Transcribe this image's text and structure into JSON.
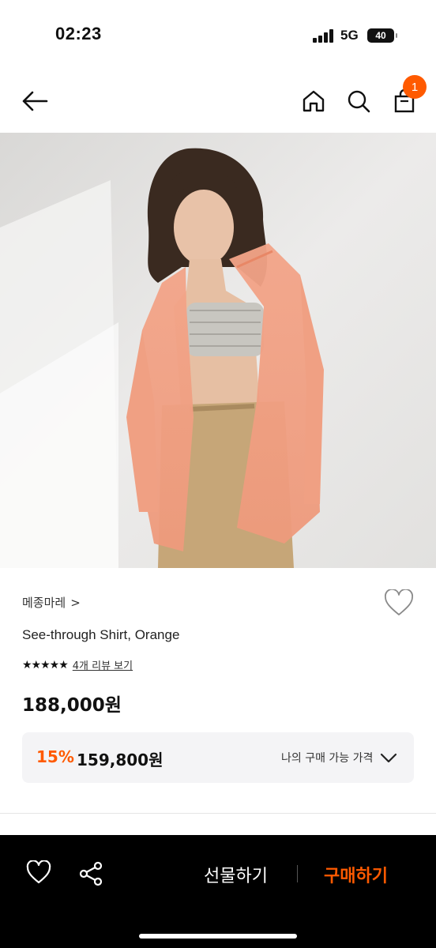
{
  "status_bar": {
    "time": "02:23",
    "network": "5G",
    "battery": "40"
  },
  "header": {
    "back_icon": "arrow-left-icon",
    "home_icon": "home-icon",
    "search_icon": "search-icon",
    "cart_icon": "shopping-bag-icon",
    "cart_count": "1"
  },
  "product": {
    "brand": "메종마레",
    "brand_chevron": ">",
    "name": "See-through Shirt, Orange",
    "stars": "★★★★★",
    "review_link": "4개 리뷰 보기",
    "price": "188,000원"
  },
  "discount": {
    "percent": "15%",
    "price": "159,800원",
    "label": "나의 구매 가능 가격"
  },
  "bottom_bar": {
    "wish_icon": "heart-icon",
    "share_icon": "share-icon",
    "gift_label": "선물하기",
    "buy_label": "구매하기"
  },
  "colors": {
    "accent": "#ff5a00",
    "bottom_bar_bg": "#000000",
    "discount_box_bg": "#f4f4f6"
  }
}
